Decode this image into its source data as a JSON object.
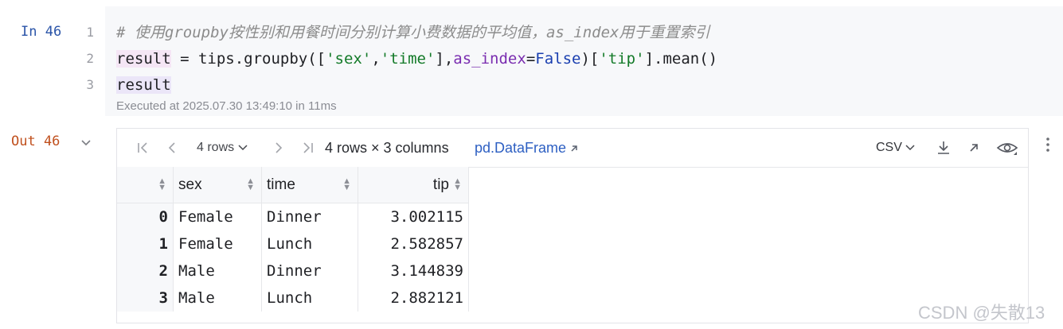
{
  "cell": {
    "in_label": "In 46",
    "out_label": "Out 46",
    "line_numbers": [
      "1",
      "2",
      "3"
    ],
    "code": {
      "comment": "# 使用groupby按性别和用餐时间分别计算小费数据的平均值，as_index用于重置索引",
      "line2": {
        "result": "result",
        "eq": " = tips.groupby([",
        "s1": "'sex'",
        "comma": ",",
        "s2": "'time'",
        "mid": "],",
        "kw": "as_index",
        "eq2": "=",
        "bool": "False",
        "mid2": ")[",
        "s3": "'tip'",
        "end": "].mean()"
      },
      "line3": "result"
    },
    "executed": "Executed at 2025.07.30 13:49:10 in 11ms"
  },
  "output": {
    "rows_selector": "4 rows",
    "dims": "4 rows × 3 columns",
    "df_link": "pd.DataFrame",
    "csv": "CSV",
    "columns": [
      "sex",
      "time",
      "tip"
    ],
    "rows": [
      {
        "idx": "0",
        "sex": "Female",
        "time": "Dinner",
        "tip": "3.002115"
      },
      {
        "idx": "1",
        "sex": "Female",
        "time": "Lunch",
        "tip": "2.582857"
      },
      {
        "idx": "2",
        "sex": "Male",
        "time": "Dinner",
        "tip": "3.144839"
      },
      {
        "idx": "3",
        "sex": "Male",
        "time": "Lunch",
        "tip": "2.882121"
      }
    ]
  },
  "watermark": "CSDN @失散13",
  "icons": {
    "first": "first-page-icon",
    "prev": "prev-page-icon",
    "next": "next-page-icon",
    "last": "last-page-icon",
    "download": "download-icon",
    "open": "open-external-icon",
    "eye": "eye-icon",
    "more": "more-vertical-icon"
  }
}
